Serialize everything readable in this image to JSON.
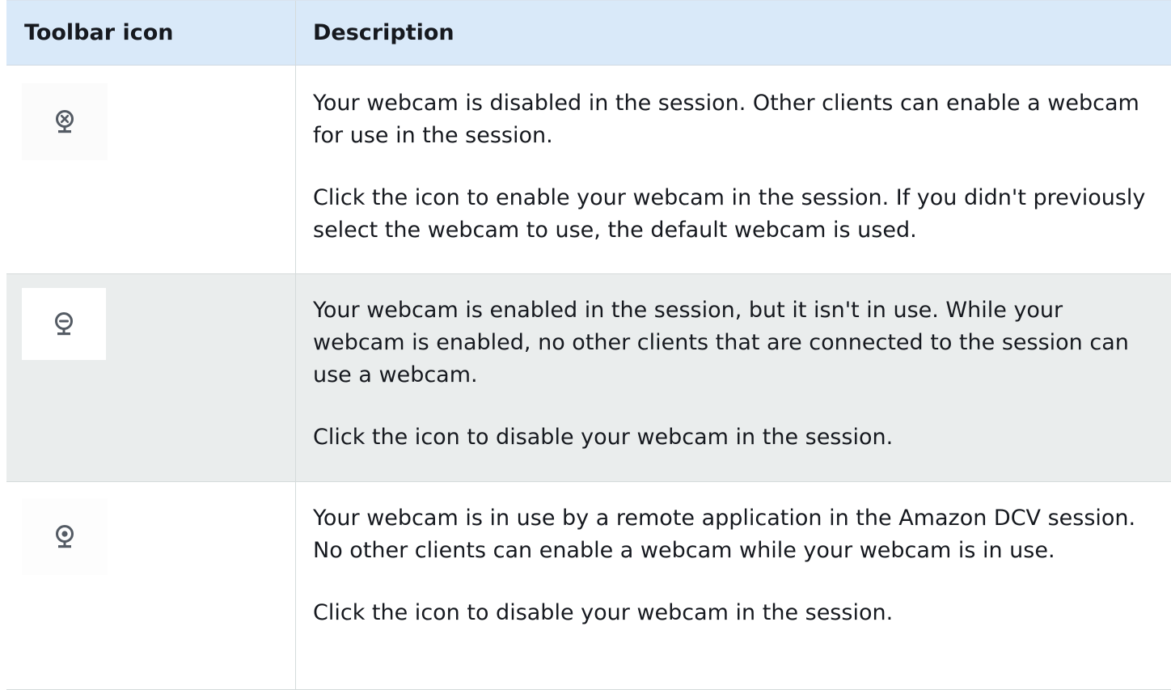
{
  "table": {
    "headers": {
      "icon": "Toolbar icon",
      "description": "Description"
    },
    "rows": [
      {
        "icon": "webcam-disabled-icon",
        "paragraphs": [
          "Your webcam is disabled in the session. Other clients can enable a webcam for use in the session.",
          "Click the icon to enable your webcam in the session. If you didn't previously select the webcam to use, the default webcam is used."
        ]
      },
      {
        "icon": "webcam-enabled-idle-icon",
        "paragraphs": [
          "Your webcam is enabled in the session, but it isn't in use. While your webcam is enabled, no other clients that are connected to the session can use a webcam.",
          "Click the icon to disable your webcam in the session."
        ]
      },
      {
        "icon": "webcam-in-use-icon",
        "paragraphs": [
          "Your webcam is in use by a remote application in the Amazon DCV session. No other clients can enable a webcam while your webcam is in use.",
          "Click the icon to disable your webcam in the session."
        ]
      }
    ]
  },
  "colors": {
    "header_background": "#d9e9f9",
    "shaded_row_background": "#eaeded",
    "icon_color": "#545b64",
    "text_color": "#16191f"
  }
}
